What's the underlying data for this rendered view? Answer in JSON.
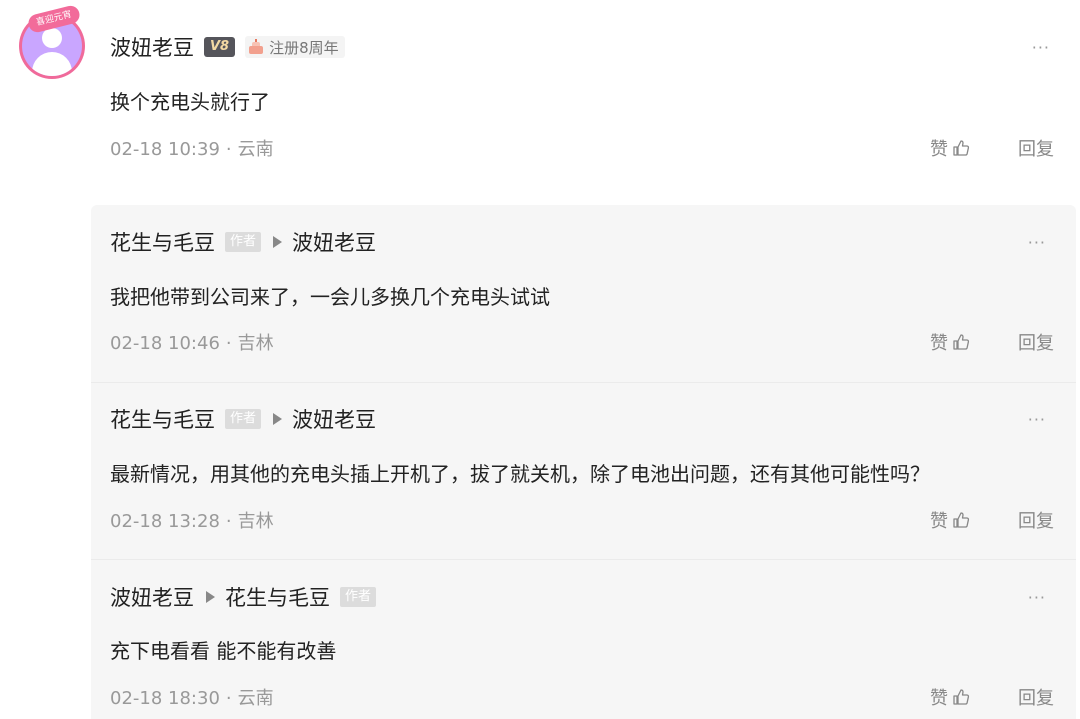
{
  "main_comment": {
    "avatar_badge": "喜迎元宵",
    "author": "波妞老豆",
    "level": "V8",
    "anniversary": "注册8周年",
    "text": "换个充电头就行了",
    "time": "02-18 10:39",
    "location": "云南",
    "like_label": "赞",
    "reply_label": "回复",
    "more": "···"
  },
  "replies": [
    {
      "author": "花生与毛豆",
      "author_tag": "作者",
      "reply_to": "波妞老豆",
      "text": "我把他带到公司来了，一会儿多换几个充电头试试",
      "time": "02-18 10:46",
      "location": "吉林",
      "like_label": "赞",
      "reply_label": "回复",
      "more": "···"
    },
    {
      "author": "花生与毛豆",
      "author_tag": "作者",
      "reply_to": "波妞老豆",
      "text": "最新情况，用其他的充电头插上开机了，拔了就关机，除了电池出问题，还有其他可能性吗？",
      "time": "02-18 13:28",
      "location": "吉林",
      "like_label": "赞",
      "reply_label": "回复",
      "more": "···"
    },
    {
      "author": "波妞老豆",
      "reply_to": "花生与毛豆",
      "reply_to_tag": "作者",
      "text": "充下电看看 能不能有改善",
      "time": "02-18 18:30",
      "location": "云南",
      "like_label": "赞",
      "reply_label": "回复",
      "more": "···"
    }
  ],
  "colors": {
    "reply_bg": "#f6f6f6",
    "meta_text": "#999999",
    "level_badge_bg": "#55555b",
    "author_tag_bg": "#dcdcdc",
    "avatar_ring": "#f06a9a"
  }
}
